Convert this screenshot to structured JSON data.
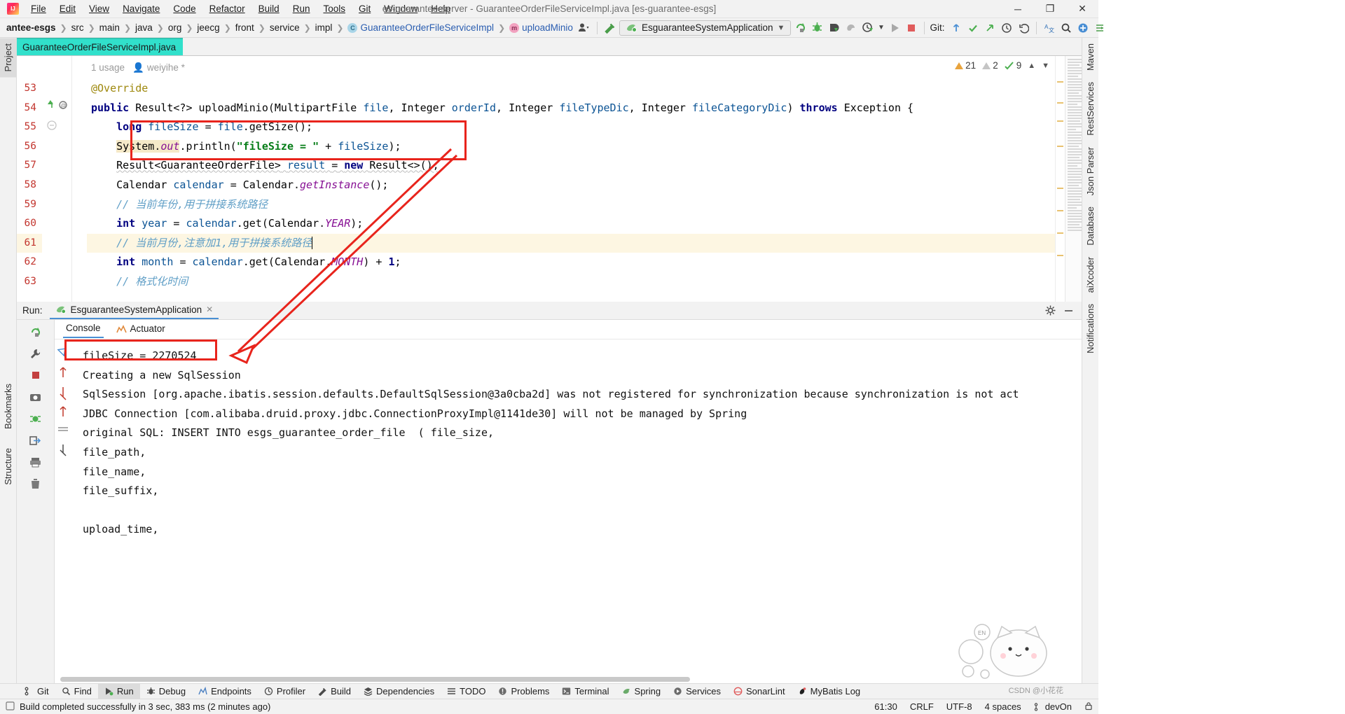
{
  "window": {
    "title": "es-guarantee-server - GuaranteeOrderFileServiceImpl.java [es-guarantee-esgs]",
    "minimize": "─",
    "maximize": "❐",
    "close": "✕"
  },
  "menu": [
    "File",
    "Edit",
    "View",
    "Navigate",
    "Code",
    "Refactor",
    "Build",
    "Run",
    "Tools",
    "Git",
    "Window",
    "Help"
  ],
  "breadcrumbs": [
    {
      "label": "antee-esgs",
      "bold": true
    },
    {
      "label": "src"
    },
    {
      "label": "main"
    },
    {
      "label": "java"
    },
    {
      "label": "org"
    },
    {
      "label": "jeecg"
    },
    {
      "label": "front"
    },
    {
      "label": "service"
    },
    {
      "label": "impl"
    },
    {
      "label": "GuaranteeOrderFileServiceImpl",
      "icon": "c",
      "blue": true
    },
    {
      "label": "uploadMinio",
      "icon": "m",
      "blue": true
    }
  ],
  "toolbar": {
    "run_config": "EsguaranteeSystemApplication",
    "git_label": "Git:",
    "icons": [
      "user-avatar-icon",
      "hammer-icon",
      "rerun-icon",
      "debug-icon",
      "coverage-icon",
      "profiler-icon",
      "history-icon",
      "run-icon",
      "stop-icon",
      "git-update-icon",
      "git-commit-icon",
      "git-push-icon",
      "git-history-icon",
      "undo-icon",
      "translate-icon",
      "search-icon",
      "settings-icon",
      "account-icon"
    ]
  },
  "editor_tab": {
    "label": "GuaranteeOrderFileServiceImpl.java",
    "icon": "c"
  },
  "code_hint": {
    "usage": "1 usage",
    "author": "weiyihe *"
  },
  "inspections": {
    "warnings": "21",
    "weak_warnings": "2",
    "checks": "9"
  },
  "code_lines": [
    {
      "n": "53",
      "text": "@Override"
    },
    {
      "n": "54",
      "text": "public Result<?> uploadMinio(MultipartFile file, Integer orderId, Integer fileTypeDic, Integer fileCategoryDic) throws Exception {"
    },
    {
      "n": "55",
      "text": "long fileSize = file.getSize();"
    },
    {
      "n": "56",
      "text": "System.out.println(\"fileSize = \" + fileSize);"
    },
    {
      "n": "57",
      "text": "Result<GuaranteeOrderFile> result = new Result<>();"
    },
    {
      "n": "58",
      "text": "Calendar calendar = Calendar.getInstance();"
    },
    {
      "n": "59",
      "text": "// 当前年份,用于拼接系统路径"
    },
    {
      "n": "60",
      "text": "int year = calendar.get(Calendar.YEAR);"
    },
    {
      "n": "61",
      "text": "// 当前月份,注意加1,用于拼接系统路径",
      "highlighted": true
    },
    {
      "n": "62",
      "text": "int month = calendar.get(Calendar.MONTH) + 1;"
    },
    {
      "n": "63",
      "text": "// 格式化时间"
    }
  ],
  "run_panel": {
    "label": "Run:",
    "config_name": "EsguaranteeSystemApplication",
    "close_icon": "✕",
    "tabs": [
      {
        "label": "Console",
        "selected": true
      },
      {
        "label": "Actuator",
        "selected": false
      }
    ],
    "sidebar_icons": [
      "rerun-icon",
      "wrench-icon",
      "stop-icon",
      "camera-icon",
      "thread-dump-icon",
      "exit-icon",
      "print-icon",
      "trash-icon",
      "up-icon",
      "down-icon",
      "soft-wrap-icon",
      "scroll-end-icon",
      "scroll-top-icon"
    ],
    "output": [
      "fileSize = 2270524",
      "Creating a new SqlSession",
      "SqlSession [org.apache.ibatis.session.defaults.DefaultSqlSession@3a0cba2d] was not registered for synchronization because synchronization is not act",
      "JDBC Connection [com.alibaba.druid.proxy.jdbc.ConnectionProxyImpl@1141de30] will not be managed by Spring",
      "original SQL: INSERT INTO esgs_guarantee_order_file  ( file_size,",
      "file_path,",
      "file_name,",
      "file_suffix,",
      "",
      "upload_time,"
    ]
  },
  "left_strip": [
    "Project",
    "Bookmarks",
    "Structure"
  ],
  "right_strip": [
    "Maven",
    "RestServices",
    "Json Parser",
    "Database",
    "aiXcoder",
    "Notifications",
    "devOn"
  ],
  "bottom_bar": [
    {
      "label": "Git",
      "icon": "git-branch-icon"
    },
    {
      "label": "Find",
      "icon": "search-icon"
    },
    {
      "label": "Run",
      "icon": "run-icon",
      "selected": true
    },
    {
      "label": "Debug",
      "icon": "debug-icon"
    },
    {
      "label": "Endpoints",
      "icon": "endpoints-icon"
    },
    {
      "label": "Profiler",
      "icon": "profiler-icon"
    },
    {
      "label": "Build",
      "icon": "hammer-icon"
    },
    {
      "label": "Dependencies",
      "icon": "dependencies-icon"
    },
    {
      "label": "TODO",
      "icon": "todo-icon"
    },
    {
      "label": "Problems",
      "icon": "problems-icon"
    },
    {
      "label": "Terminal",
      "icon": "terminal-icon"
    },
    {
      "label": "Spring",
      "icon": "spring-icon"
    },
    {
      "label": "Services",
      "icon": "services-icon"
    },
    {
      "label": "SonarLint",
      "icon": "sonarlint-icon"
    },
    {
      "label": "MyBatis Log",
      "icon": "mybatis-icon"
    }
  ],
  "status_bar": {
    "message": "Build completed successfully in 3 sec, 383 ms (2 minutes ago)",
    "caret": "61:30",
    "line_sep": "CRLF",
    "encoding": "UTF-8",
    "indent": "4 spaces",
    "branch": "devOn",
    "lock_icon": "⬜"
  },
  "watermark": "CSDN @小花花",
  "colors": {
    "accent_red": "#e8241c",
    "tab_active": "#31e0cb",
    "tab_underline": "#4a8fd4",
    "highlight_line": "#fdf6e2"
  }
}
